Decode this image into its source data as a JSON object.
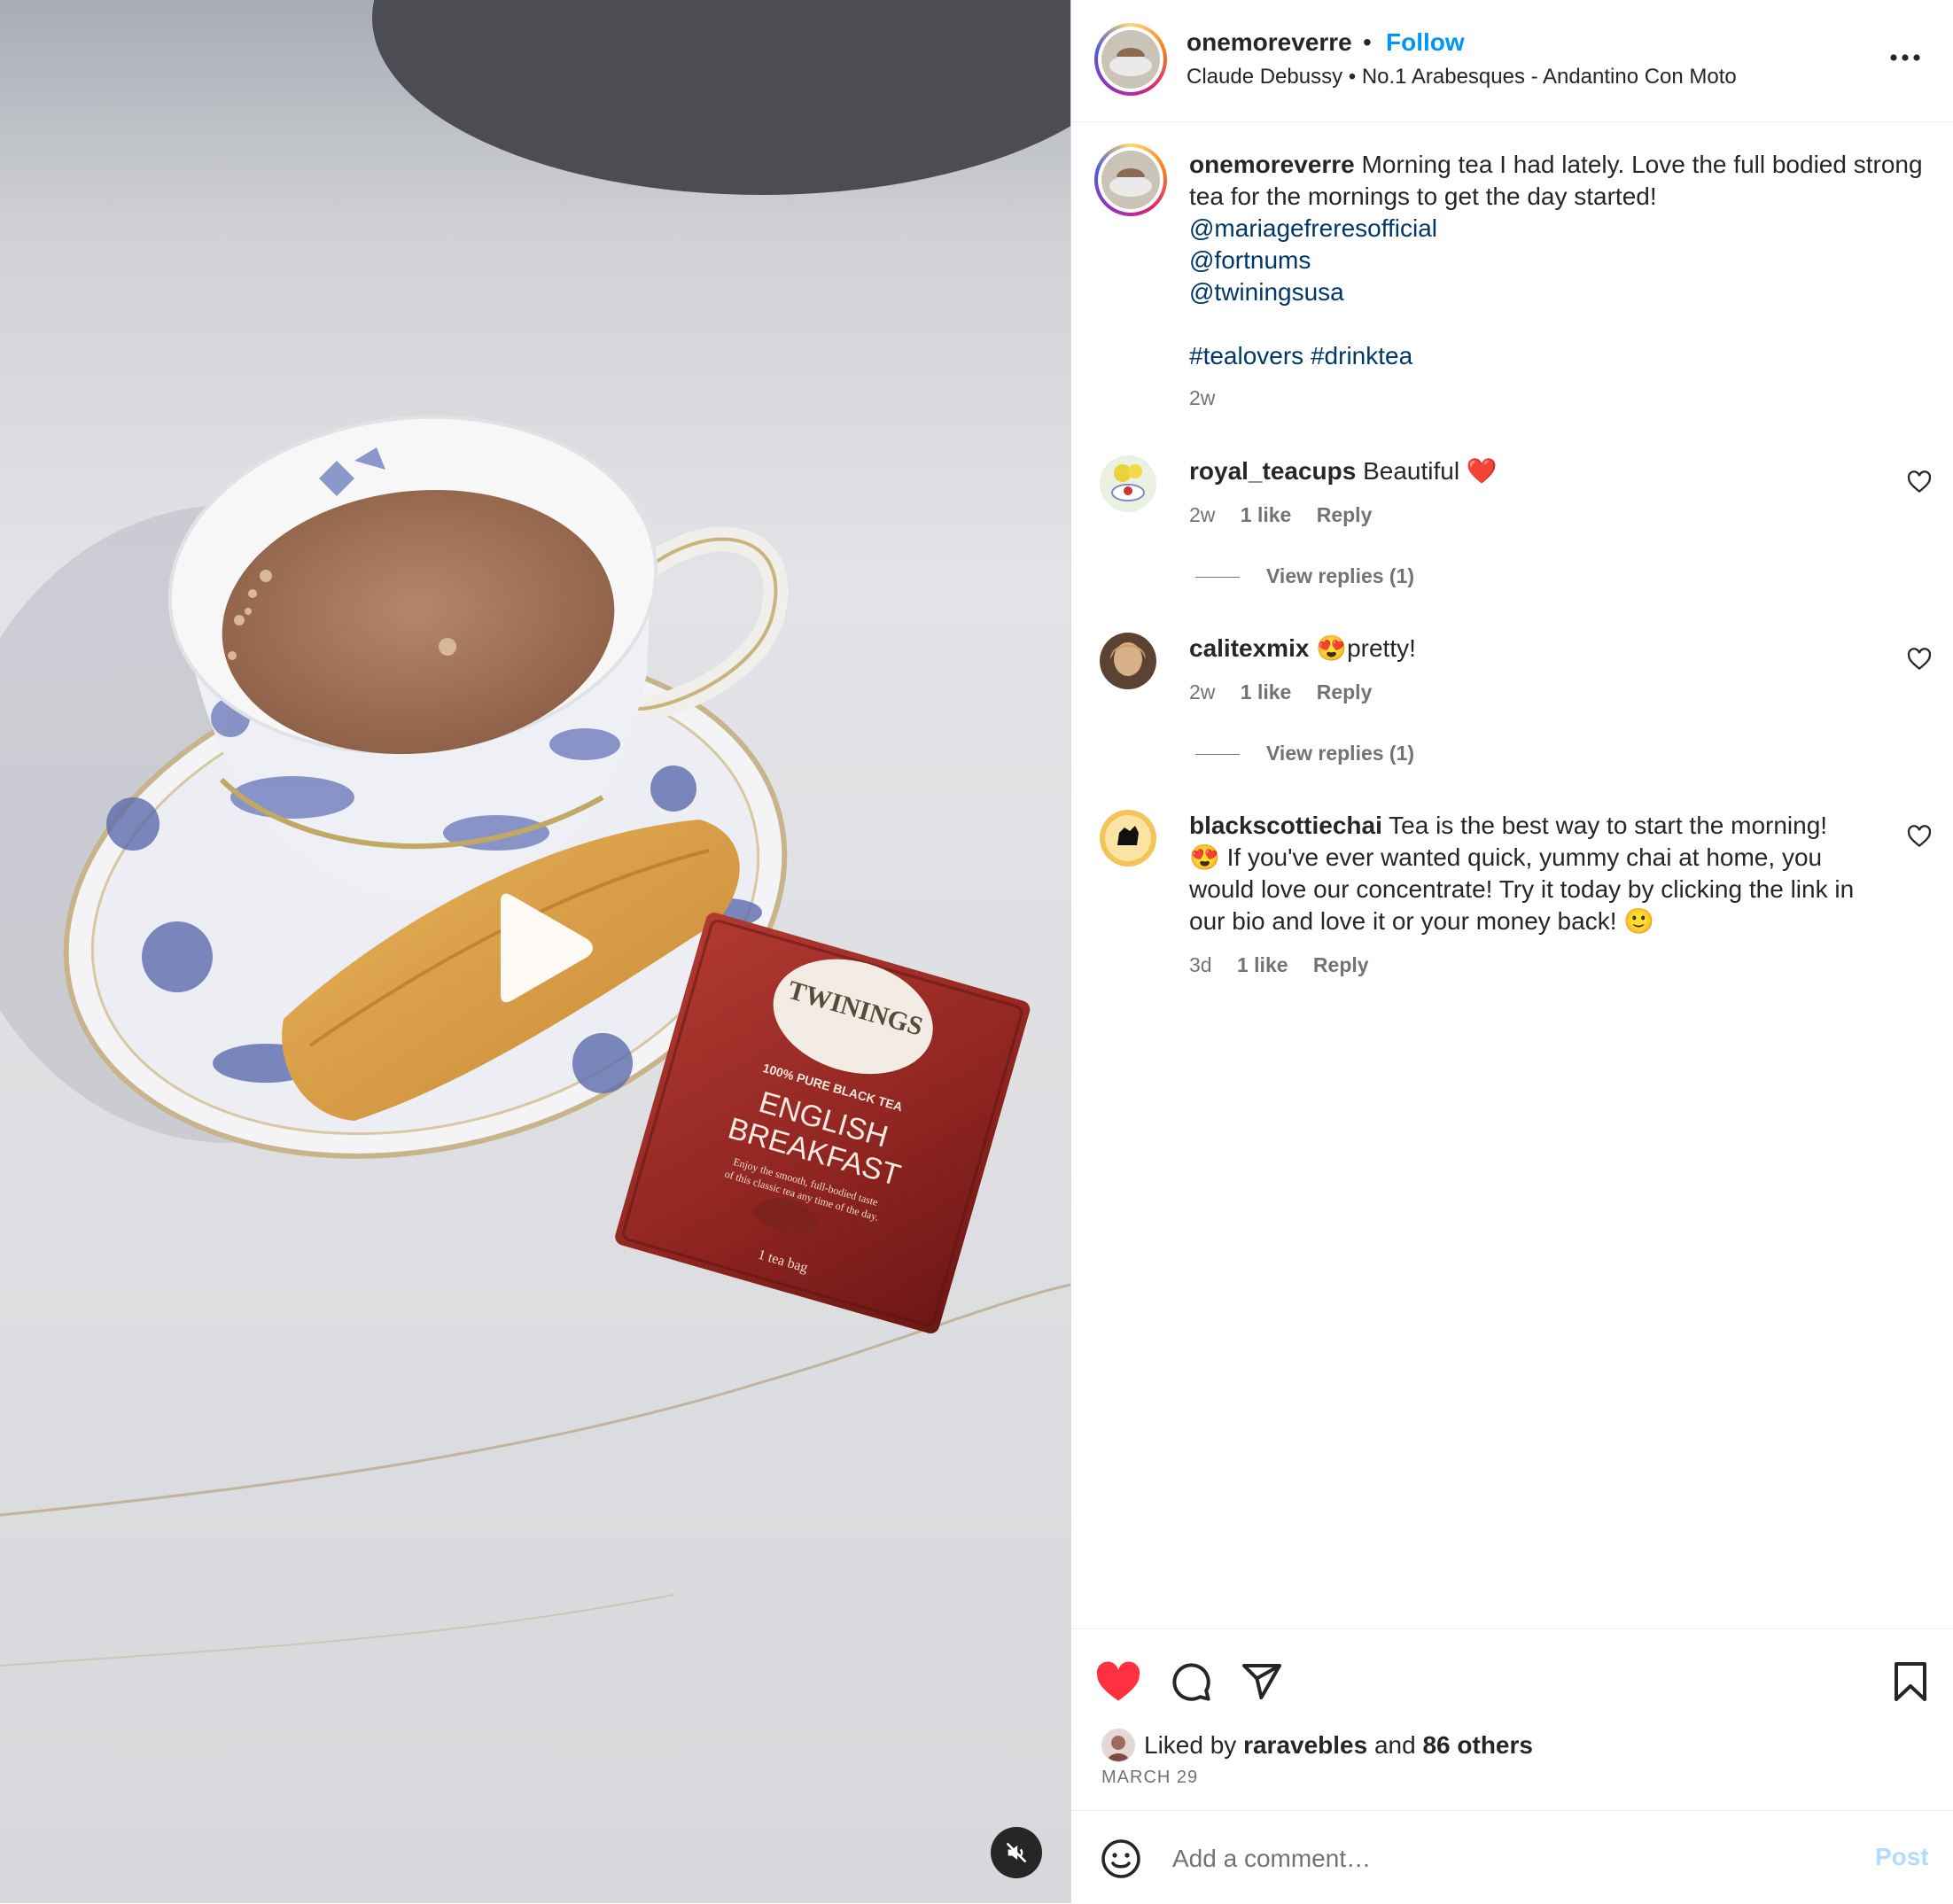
{
  "header": {
    "username": "onemoreverre",
    "separator": "•",
    "follow_label": "Follow",
    "audio": "Claude Debussy • No.1 Arabesques - Andantino Con Moto"
  },
  "caption": {
    "username": "onemoreverre",
    "text": "Morning tea I had lately. Love the full bodied strong tea for the mornings to get the day started!",
    "mentions": [
      "@mariagefreresofficial",
      "@fortnums",
      "@twiningsusa"
    ],
    "hashtags": [
      "#tealovers",
      "#drinktea"
    ],
    "time": "2w"
  },
  "comments": [
    {
      "username": "royal_teacups",
      "text": "Beautiful ❤️",
      "time": "2w",
      "likes": "1 like",
      "reply": "Reply",
      "view_replies": "View replies (1)"
    },
    {
      "username": "calitexmix",
      "text": "😍pretty!",
      "time": "2w",
      "likes": "1 like",
      "reply": "Reply",
      "view_replies": "View replies (1)"
    },
    {
      "username": "blackscottiechai",
      "text": "Tea is the best way to start the morning! 😍 If you've ever wanted quick, yummy chai at home, you would love our concentrate! Try it today by clicking the link in our bio and love it or your money back! 🙂",
      "time": "3d",
      "likes": "1 like",
      "reply": "Reply"
    }
  ],
  "likes": {
    "prefix": "Liked by",
    "user": "raravebles",
    "conjunction": "and",
    "others": "86 others"
  },
  "date": "MARCH 29",
  "comment_box": {
    "placeholder": "Add a comment…",
    "post_label": "Post"
  },
  "media": {
    "tea_bag_brand": "TWININGS",
    "tea_bag_tagline": "100% PURE BLACK TEA",
    "tea_bag_name_1": "ENGLISH",
    "tea_bag_name_2": "BREAKFAST",
    "tea_bag_desc_1": "Enjoy the smooth, full-bodied taste",
    "tea_bag_desc_2": "of this classic tea any time of the day.",
    "tea_bag_count": "1 tea bag"
  },
  "colors": {
    "follow": "#0095f6",
    "link": "#00376b",
    "like_red": "#ff3040",
    "muted_text": "#737373",
    "post_disabled": "#b3dbff"
  },
  "icons": [
    "play-icon",
    "mute-icon",
    "more-icon",
    "heart-icon",
    "comment-icon",
    "share-icon",
    "bookmark-icon",
    "emoji-icon"
  ]
}
